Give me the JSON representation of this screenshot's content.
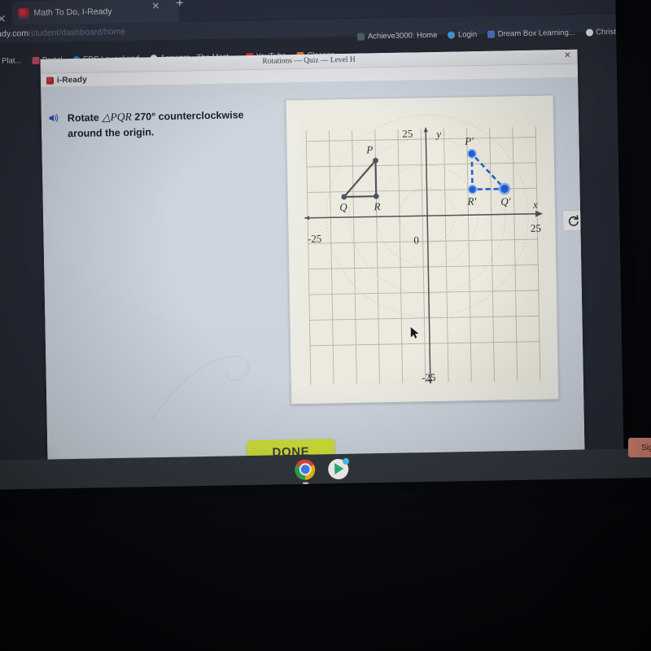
{
  "browser": {
    "tab": {
      "title": "Math To Do, I-Ready",
      "favicon": "iready-favicon-icon",
      "close": "✕"
    },
    "new_tab_label": "+",
    "window_close_label": "✕",
    "url_host": "i-ready.com",
    "url_path": "/student/dashboard/home",
    "bookmarks_row1": [
      {
        "label": "Achieve3000: Home",
        "icon": "bookmark-generic-icon"
      },
      {
        "label": "Login",
        "icon": "cloud-icon"
      },
      {
        "label": "Dream Box Learning...",
        "icon": "dreambox-icon"
      },
      {
        "label": "Christ",
        "icon": "swirl-icon"
      }
    ],
    "bookmarks_row2": [
      {
        "label": "...ning Plat...",
        "icon": "learning-platform-icon"
      },
      {
        "label": "Portal",
        "icon": "portal-icon"
      },
      {
        "label": "EDS Launchpad",
        "icon": "cloud-icon"
      },
      {
        "label": "Answers - The Most...",
        "icon": "swirl-icon"
      },
      {
        "label": "YouTube",
        "icon": "youtube-icon"
      },
      {
        "label": "Classes",
        "icon": "classes-icon"
      }
    ]
  },
  "page": {
    "quiz_title": "Rotations — Quiz — Level H",
    "close_label": "✕",
    "app_name": "i-Ready",
    "prompt_line1_pre": "Rotate ",
    "prompt_line1_math": "△PQR",
    "prompt_line1_post": " 270° counterclockwise",
    "prompt_line2": "around the origin.",
    "speaker_icon": "speaker-icon",
    "done_label": "DONE",
    "reset_icon": "reset-rotate-icon",
    "signout_label": "Sign"
  },
  "shelf": {
    "apps": [
      {
        "name": "chrome-app-icon"
      },
      {
        "name": "play-store-app-icon"
      }
    ]
  },
  "chart_data": {
    "type": "scatter",
    "title": "Coordinate plane with triangle PQR and image P'Q'R'",
    "xlabel": "x",
    "ylabel": "y",
    "xlim": [
      -25,
      25
    ],
    "ylim": [
      -25,
      25
    ],
    "grid": true,
    "grid_step": 5,
    "axis_tick_labels": {
      "x_right": "25",
      "x_left": "-25",
      "y_top": "25",
      "y_bottom": "-25",
      "origin": "0"
    },
    "guide_circles_radii": [
      6,
      11,
      17,
      22
    ],
    "series": [
      {
        "name": "Triangle PQR (preimage)",
        "color": "#4a4f5a",
        "style": "solid",
        "closed": true,
        "points": [
          {
            "label": "P",
            "x": -10,
            "y": 11
          },
          {
            "label": "Q",
            "x": -17,
            "y": 4
          },
          {
            "label": "R",
            "x": -10,
            "y": 4
          }
        ]
      },
      {
        "name": "Triangle P'Q'R' (image)",
        "color": "#1f62d6",
        "style": "dashed",
        "closed": true,
        "points": [
          {
            "label": "P'",
            "x": 11,
            "y": 12
          },
          {
            "label": "R'",
            "x": 11,
            "y": 5
          },
          {
            "label": "Q'",
            "x": 18,
            "y": 5
          }
        ]
      }
    ],
    "cursor": {
      "x": -3,
      "y": -23,
      "icon": "mouse-cursor-icon"
    }
  }
}
